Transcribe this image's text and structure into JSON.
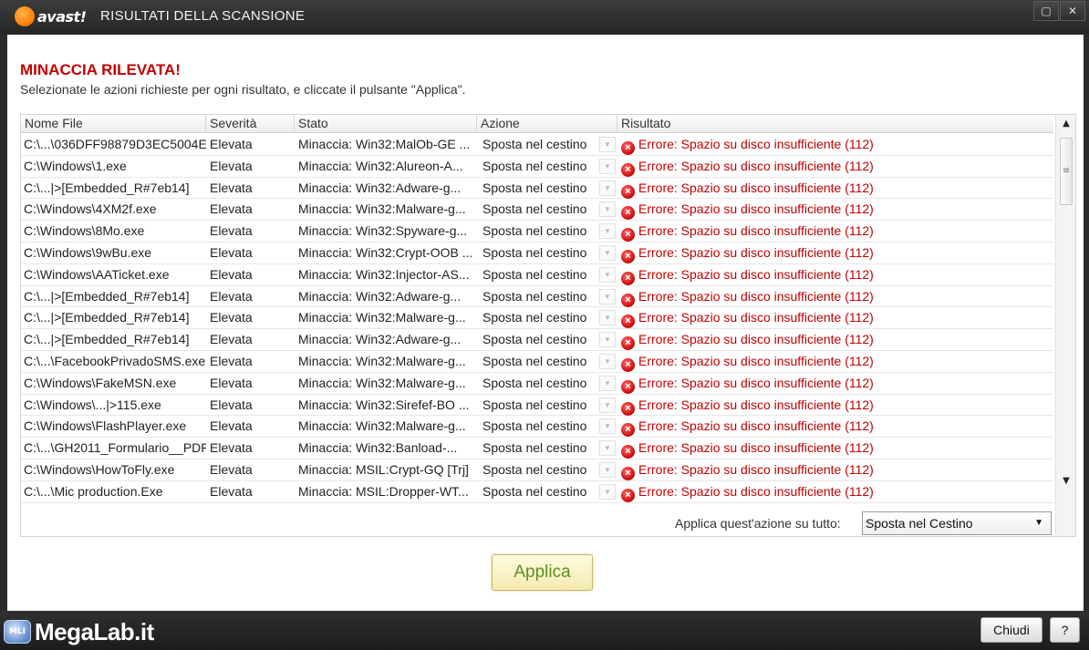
{
  "window": {
    "logo_text": "avast!",
    "title": "RISULTATI DELLA SCANSIONE",
    "maximize_glyph": "▢",
    "close_glyph": "✕"
  },
  "header": {
    "threat_title": "MINACCIA RILEVATA!",
    "subtitle": "Selezionate le azioni richieste per ogni risultato, e cliccate il pulsante \"Applica\"."
  },
  "table": {
    "columns": [
      "Nome File",
      "Severità",
      "Stato",
      "Azione",
      "Risultato"
    ],
    "rows": [
      {
        "file": "C:\\...\\036DFF98879D3EC5004E",
        "severity": "Elevata",
        "status": "Minaccia: Win32:MalOb-GE ...",
        "action": "Sposta nel cestino",
        "result": "Errore: Spazio su disco insufficiente (112)"
      },
      {
        "file": "C:\\Windows\\1.exe",
        "severity": "Elevata",
        "status": "Minaccia: Win32:Alureon-A...",
        "action": "Sposta nel cestino",
        "result": "Errore: Spazio su disco insufficiente (112)"
      },
      {
        "file": "C:\\...|>[Embedded_R#7eb14]",
        "severity": "Elevata",
        "status": "Minaccia: Win32:Adware-g...",
        "action": "Sposta nel cestino",
        "result": "Errore: Spazio su disco insufficiente (112)"
      },
      {
        "file": "C:\\Windows\\4XM2f.exe",
        "severity": "Elevata",
        "status": "Minaccia: Win32:Malware-g...",
        "action": "Sposta nel cestino",
        "result": "Errore: Spazio su disco insufficiente (112)"
      },
      {
        "file": "C:\\Windows\\8Mo.exe",
        "severity": "Elevata",
        "status": "Minaccia: Win32:Spyware-g...",
        "action": "Sposta nel cestino",
        "result": "Errore: Spazio su disco insufficiente (112)"
      },
      {
        "file": "C:\\Windows\\9wBu.exe",
        "severity": "Elevata",
        "status": "Minaccia: Win32:Crypt-OOB ...",
        "action": "Sposta nel cestino",
        "result": "Errore: Spazio su disco insufficiente (112)"
      },
      {
        "file": "C:\\Windows\\AATicket.exe",
        "severity": "Elevata",
        "status": "Minaccia: Win32:Injector-AS...",
        "action": "Sposta nel cestino",
        "result": "Errore: Spazio su disco insufficiente (112)"
      },
      {
        "file": "C:\\...|>[Embedded_R#7eb14]",
        "severity": "Elevata",
        "status": "Minaccia: Win32:Adware-g...",
        "action": "Sposta nel cestino",
        "result": "Errore: Spazio su disco insufficiente (112)"
      },
      {
        "file": "C:\\...|>[Embedded_R#7eb14]",
        "severity": "Elevata",
        "status": "Minaccia: Win32:Malware-g...",
        "action": "Sposta nel cestino",
        "result": "Errore: Spazio su disco insufficiente (112)"
      },
      {
        "file": "C:\\...|>[Embedded_R#7eb14]",
        "severity": "Elevata",
        "status": "Minaccia: Win32:Adware-g...",
        "action": "Sposta nel cestino",
        "result": "Errore: Spazio su disco insufficiente (112)"
      },
      {
        "file": "C:\\...\\FacebookPrivadoSMS.exe",
        "severity": "Elevata",
        "status": "Minaccia: Win32:Malware-g...",
        "action": "Sposta nel cestino",
        "result": "Errore: Spazio su disco insufficiente (112)"
      },
      {
        "file": "C:\\Windows\\FakeMSN.exe",
        "severity": "Elevata",
        "status": "Minaccia: Win32:Malware-g...",
        "action": "Sposta nel cestino",
        "result": "Errore: Spazio su disco insufficiente (112)"
      },
      {
        "file": "C:\\Windows\\...|>115.exe",
        "severity": "Elevata",
        "status": "Minaccia: Win32:Sirefef-BO ...",
        "action": "Sposta nel cestino",
        "result": "Errore: Spazio su disco insufficiente (112)"
      },
      {
        "file": "C:\\Windows\\FlashPlayer.exe",
        "severity": "Elevata",
        "status": "Minaccia: Win32:Malware-g...",
        "action": "Sposta nel cestino",
        "result": "Errore: Spazio su disco insufficiente (112)"
      },
      {
        "file": "C:\\...\\GH2011_Formulario__PDF",
        "severity": "Elevata",
        "status": "Minaccia: Win32:Banload-...",
        "action": "Sposta nel cestino",
        "result": "Errore: Spazio su disco insufficiente (112)"
      },
      {
        "file": "C:\\Windows\\HowToFly.exe",
        "severity": "Elevata",
        "status": "Minaccia: MSIL:Crypt-GQ [Trj]",
        "action": "Sposta nel cestino",
        "result": "Errore: Spazio su disco insufficiente (112)"
      },
      {
        "file": "C:\\...\\Mic production.Exe",
        "severity": "Elevata",
        "status": "Minaccia: MSIL:Dropper-WT...",
        "action": "Sposta nel cestino",
        "result": "Errore: Spazio su disco insufficiente (112)"
      }
    ]
  },
  "apply_all": {
    "label": "Applica quest'azione su tutto:",
    "selected": "Sposta nel Cestino"
  },
  "buttons": {
    "apply": "Applica",
    "close": "Chiudi",
    "help": "?"
  },
  "branding": {
    "watermark_icon": "MLI",
    "watermark": "MegaLab.it"
  },
  "colors": {
    "threat_red": "#c00000",
    "apply_green": "#5f8f26",
    "avast_orange": "#ff7a00"
  }
}
